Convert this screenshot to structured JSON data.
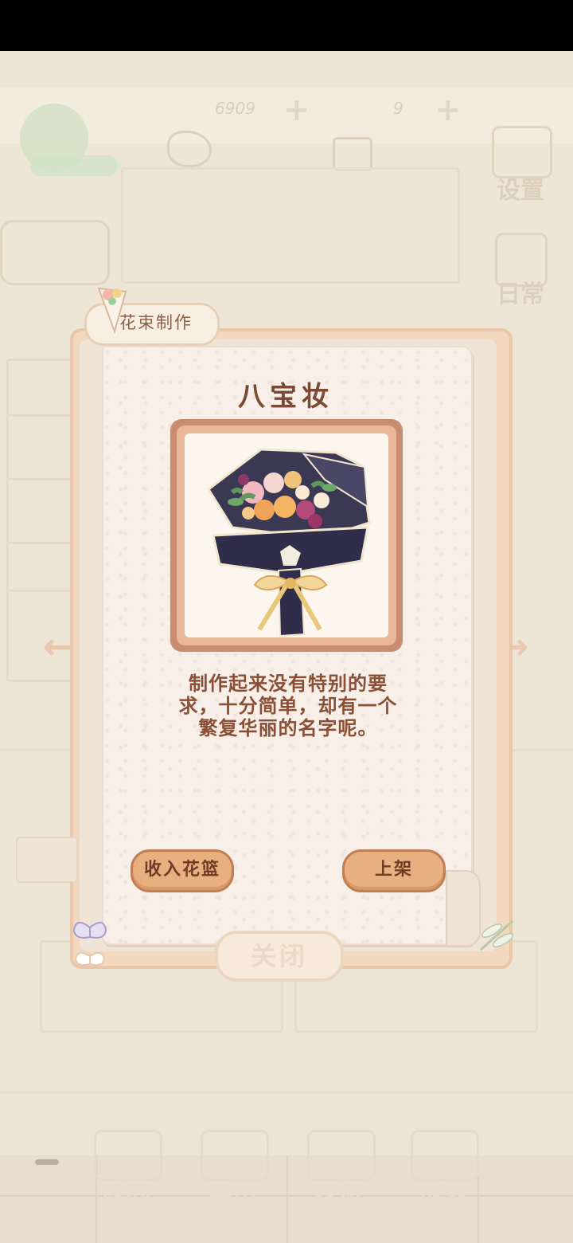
{
  "background": {
    "currency_fish": "6909",
    "currency_cake": "9",
    "side_buttons": {
      "settings": "设置",
      "daily": "日常"
    },
    "bottom_nav": [
      {
        "label": "返回",
        "icon": "back-icon"
      },
      {
        "label": "集市",
        "icon": "market-icon"
      },
      {
        "label": "花篮",
        "icon": "basket-icon"
      },
      {
        "label": "成就",
        "icon": "achievement-icon"
      }
    ]
  },
  "dialog": {
    "tab_title": "花束制作",
    "bouquet_name": "八宝妆",
    "description": "制作起来没有特别的要求，十分简单，却有一个繁复华丽的名字呢。",
    "buttons": {
      "put_in_basket": "收入花篮",
      "put_on_shelf": "上架",
      "close": "关闭"
    }
  },
  "colors": {
    "accent": "#e8b080",
    "text_brown": "#7a4a34",
    "frame": "#c98c6e"
  }
}
